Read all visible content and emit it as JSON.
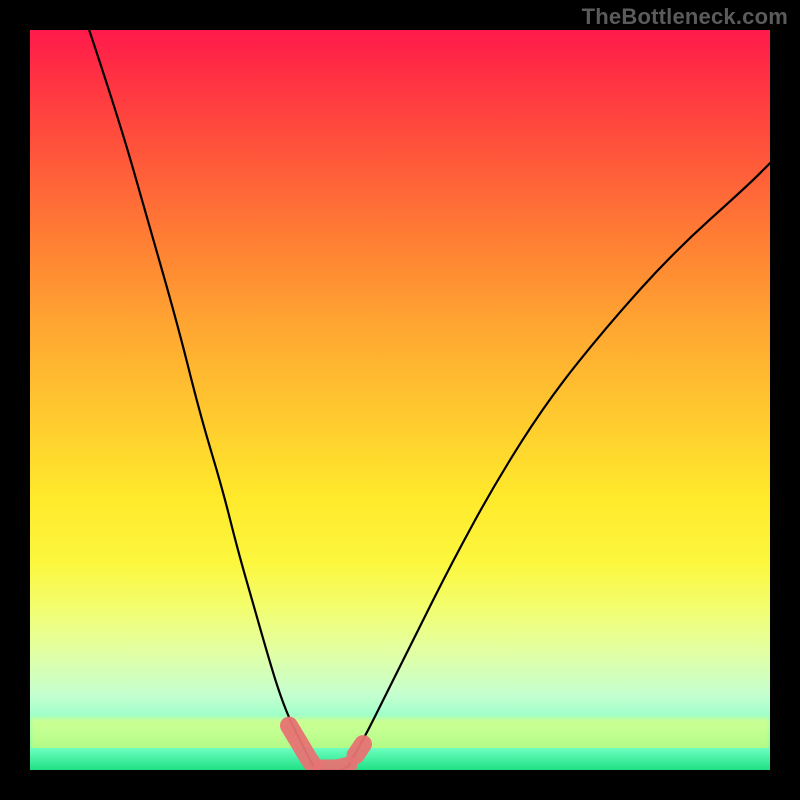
{
  "watermark": {
    "text": "TheBottleneck.com"
  },
  "chart_data": {
    "type": "line",
    "title": "",
    "xlabel": "",
    "ylabel": "",
    "xlim": [
      0,
      100
    ],
    "ylim": [
      0,
      100
    ],
    "grid": false,
    "legend": false,
    "series": [
      {
        "name": "left-curve",
        "x": [
          8,
          12,
          16,
          20,
          23,
          26,
          28,
          30,
          32,
          33.5,
          35,
          36.5,
          37.5,
          38.3
        ],
        "y": [
          100,
          88,
          74,
          60,
          48,
          38,
          30,
          23,
          16,
          11,
          7,
          4,
          2,
          0.5
        ]
      },
      {
        "name": "right-curve",
        "x": [
          43,
          45,
          48,
          52,
          57,
          63,
          70,
          78,
          87,
          97,
          100
        ],
        "y": [
          0.5,
          4,
          10,
          18,
          28,
          39,
          50,
          60,
          70,
          79,
          82
        ]
      },
      {
        "name": "valley-floor",
        "x": [
          38.3,
          39.5,
          41,
          42,
          43
        ],
        "y": [
          0.5,
          0,
          0,
          0,
          0.5
        ]
      }
    ],
    "highlight_region": {
      "description": "pink thick marker at valley bottom and lower curve segments",
      "x": [
        35,
        36.5,
        37.5,
        38.3,
        39.5,
        41,
        42,
        43,
        44,
        45
      ],
      "y": [
        6,
        3.5,
        1.8,
        0.6,
        0.2,
        0.2,
        0.3,
        0.6,
        2,
        3.5
      ]
    },
    "background_gradient": {
      "orientation": "vertical",
      "stops": [
        {
          "pos": 0.0,
          "color": "#ff1a4b"
        },
        {
          "pos": 0.3,
          "color": "#ff8433"
        },
        {
          "pos": 0.63,
          "color": "#ffe92b"
        },
        {
          "pos": 0.9,
          "color": "#c4ffd0"
        },
        {
          "pos": 1.0,
          "color": "#28e98a"
        }
      ]
    }
  }
}
